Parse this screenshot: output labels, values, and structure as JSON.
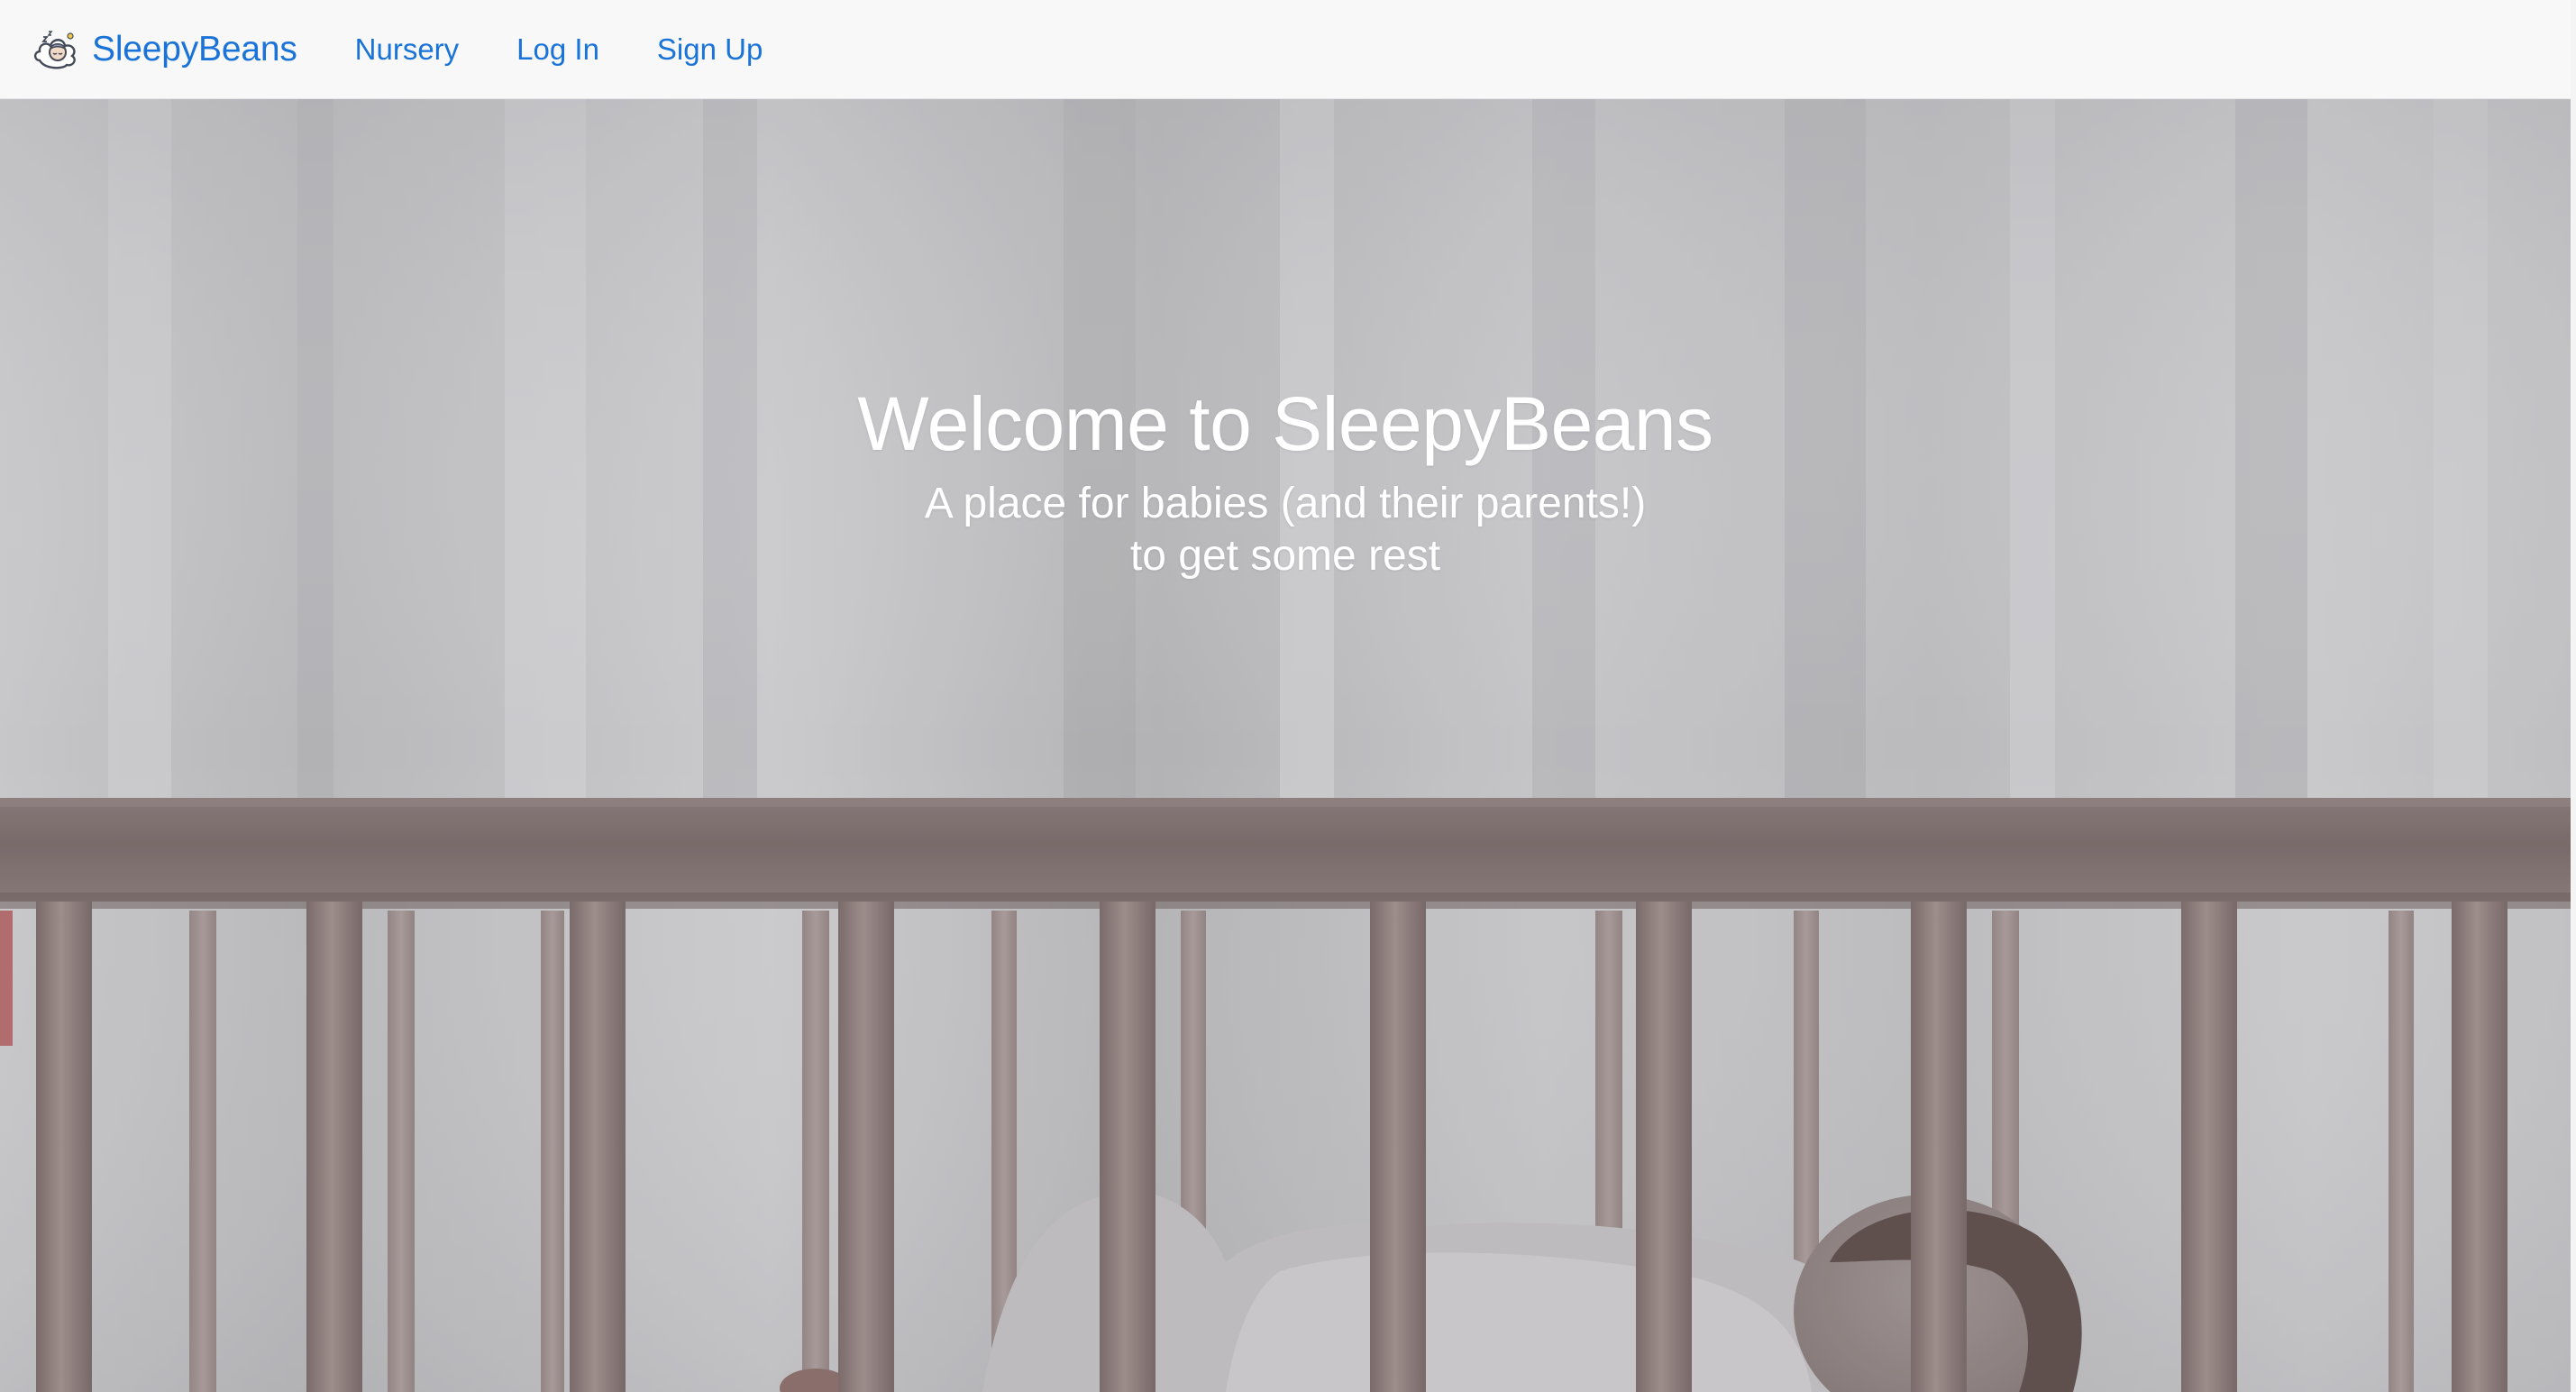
{
  "brand": {
    "name": "SleepyBeans",
    "logo_icon": "sleeping-baby-cloud-icon"
  },
  "nav": {
    "items": [
      {
        "label": "Nursery"
      },
      {
        "label": "Log In"
      },
      {
        "label": "Sign Up"
      }
    ]
  },
  "hero": {
    "title": "Welcome to SleepyBeans",
    "subtitle_line1": "A place for babies (and their parents!)",
    "subtitle_line2": "to get some rest",
    "image": "sleeping-baby-in-crib-photo"
  },
  "colors": {
    "link": "#1a73d8",
    "navbar_bg": "#f8f8f8",
    "hero_text": "#ffffff"
  }
}
